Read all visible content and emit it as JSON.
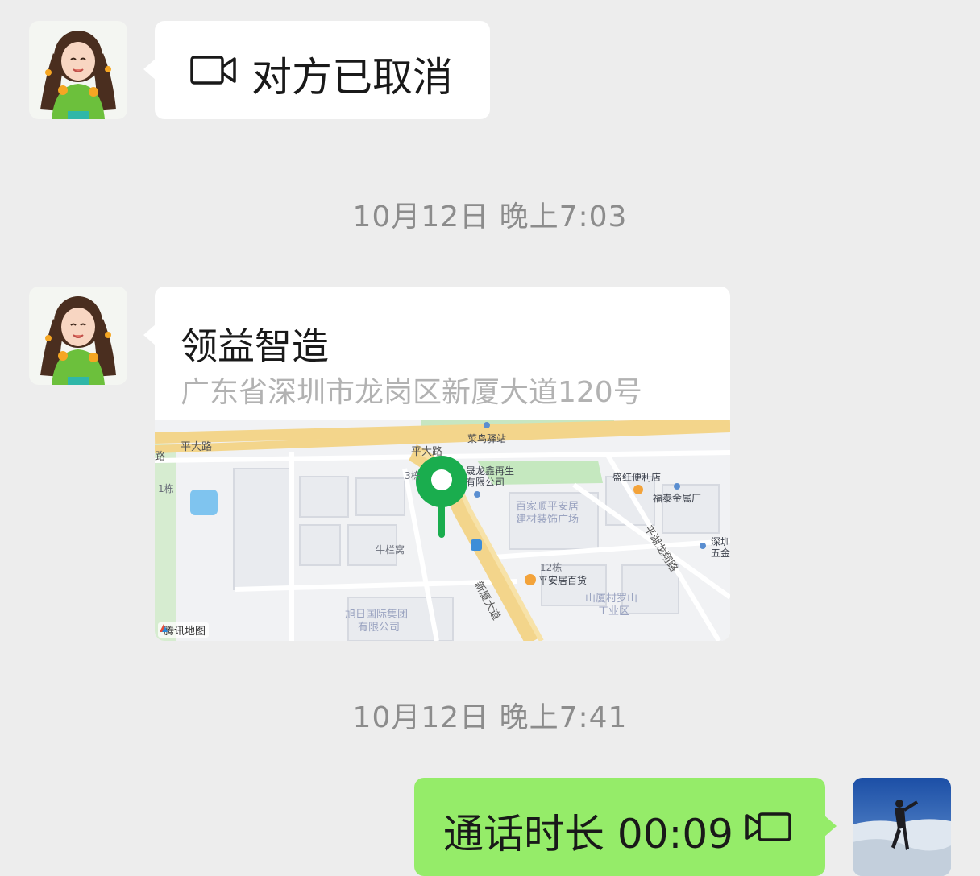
{
  "messages": {
    "call_cancelled": {
      "text": "对方已取消",
      "icon": "video-camera-icon"
    },
    "timestamp_1": "10月12日 晚上7:03",
    "location": {
      "title": "领益智造",
      "address": "广东省深圳市龙岗区新厦大道120号",
      "map": {
        "road_labels": [
          "平大路",
          "平大路",
          "新厦大道",
          "平湖龙翔路",
          "路"
        ],
        "pois": [
          "菜鸟驿站",
          "晟龙鑫再生",
          "有限公司",
          "盛红便利店",
          "福泰金属厂",
          "百家顺平安居",
          "建材装饰广场",
          "平安居百货",
          "山厦村罗山",
          "工业区",
          "旭日国际集团",
          "有限公司",
          "牛栏窝",
          "深圳",
          "五金",
          "12栋",
          "3栋",
          "1栋"
        ],
        "attribution": "腾讯地图"
      }
    },
    "timestamp_2": "10月12日 晚上7:41",
    "call_duration": {
      "text": "通话时长 00:09",
      "icon": "video-camera-icon"
    }
  },
  "colors": {
    "background": "#ededed",
    "sent_bubble": "#95ec69",
    "received_bubble": "#ffffff",
    "map_pin": "#1aad4e"
  }
}
